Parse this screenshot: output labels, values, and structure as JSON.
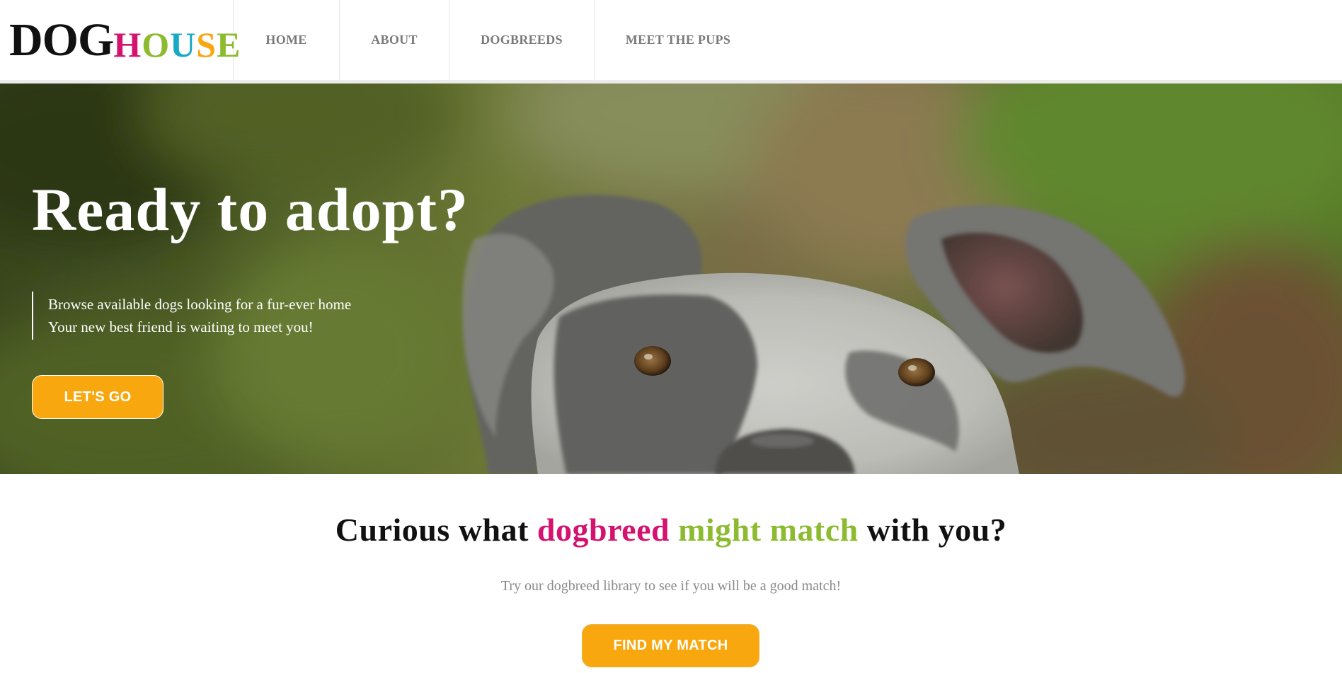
{
  "header": {
    "logo": {
      "part1": "DOG",
      "part2_letters": [
        {
          "char": "H",
          "color": "#d3136f"
        },
        {
          "char": "O",
          "color": "#8dbb2f"
        },
        {
          "char": "U",
          "color": "#19a9c7"
        },
        {
          "char": "S",
          "color": "#f9a70f"
        },
        {
          "char": "E",
          "color": "#8dbb2f"
        }
      ]
    },
    "nav": [
      {
        "label": "HOME"
      },
      {
        "label": "ABOUT"
      },
      {
        "label": "DOGBREEDS"
      },
      {
        "label": "MEET THE PUPS"
      }
    ]
  },
  "hero": {
    "title": "Ready to adopt?",
    "line1": "Browse available dogs looking for a fur-ever home",
    "line2": "Your new best friend is waiting to meet you!",
    "button_label": "LET'S GO",
    "image_subject": "grey-and-white dog face on blurred green and brown background"
  },
  "match": {
    "heading_part1": "Curious what ",
    "heading_part2": "dogbreed",
    "heading_part3": " might match",
    "heading_part4": " with you?",
    "subtitle": "Try our dogbreed library to see if you will be a good match!",
    "button_label": "FIND MY MATCH"
  },
  "colors": {
    "accent_orange": "#f9a70f",
    "accent_magenta": "#d3136f",
    "accent_green": "#8dbb2f",
    "accent_teal": "#19a9c7",
    "nav_text": "#7a7a7a",
    "subtitle_text": "#8a8a8a"
  }
}
